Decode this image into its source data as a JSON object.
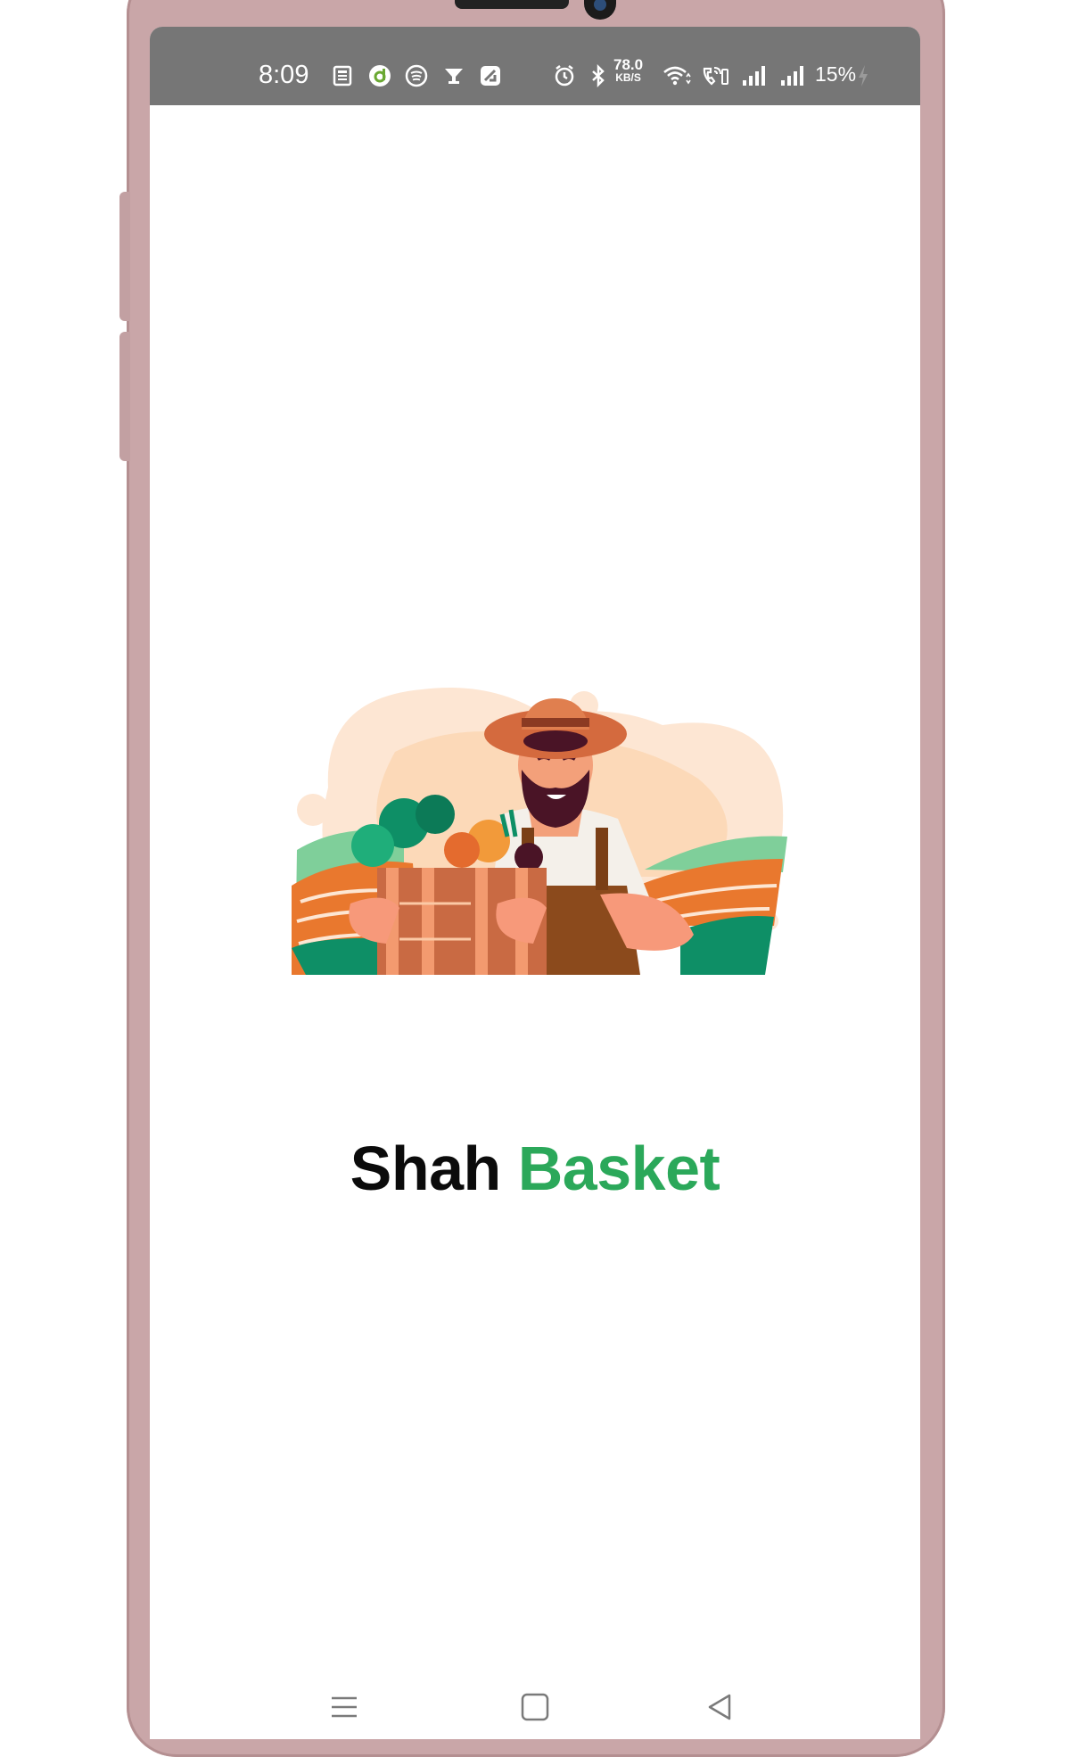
{
  "status_bar": {
    "time": "8:09",
    "net_speed_value": "78.0",
    "net_speed_unit": "KB/S",
    "battery": "15%"
  },
  "splash": {
    "title_part1": "Shah",
    "title_part2": "Basket",
    "title_part1_color": "#0b0b0b",
    "title_part2_color": "#2ba85a",
    "illustration": "farmer-holding-vegetable-crate"
  },
  "nav_bar": {
    "icons": [
      "menu-icon",
      "home-square-icon",
      "back-triangle-icon"
    ]
  },
  "colors": {
    "status_bar_bg": "#767676",
    "phone_frame": "#c9a6a8",
    "brand_green": "#2ba85a"
  }
}
